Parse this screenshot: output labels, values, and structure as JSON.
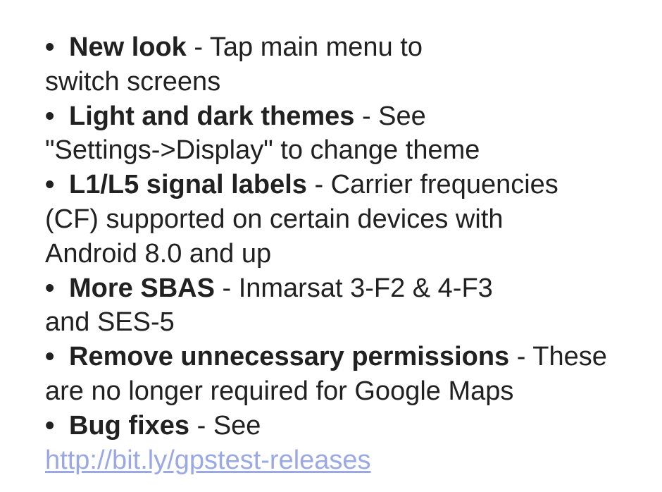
{
  "bullet_glyph": "•",
  "entries": [
    {
      "title": "New look",
      "line1": " - Tap main menu to",
      "line2": "switch screens"
    },
    {
      "title": "Light and dark themes",
      "line1": " - See",
      "line2": "\"Settings->Display\" to change theme"
    },
    {
      "title": "L1/L5 signal labels",
      "line1": " - Carrier frequencies",
      "line2": "(CF) supported on certain devices with",
      "line3": "Android 8.0 and up"
    },
    {
      "title": "More SBAS",
      "line1": " - Inmarsat 3-F2 & 4-F3",
      "line2": "and SES-5"
    },
    {
      "title": "Remove unnecessary permissions",
      "line1": " - These",
      "line2": "are no longer required for Google Maps"
    },
    {
      "title": "Bug fixes",
      "line1": " - See",
      "link": "http://bit.ly/gpstest-releases"
    }
  ],
  "colors": {
    "text": "#212121",
    "link": "#9aa8e6",
    "background": "#ffffff"
  }
}
